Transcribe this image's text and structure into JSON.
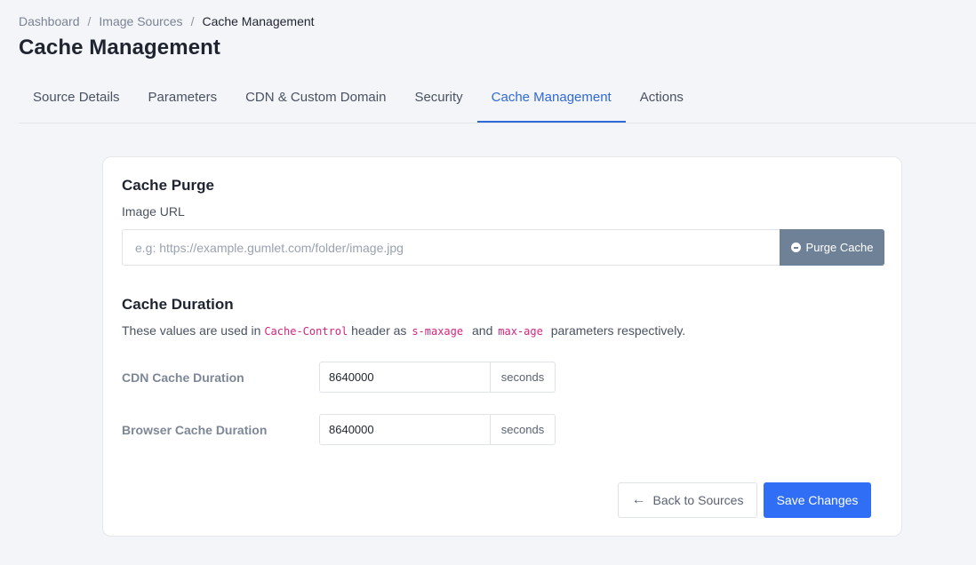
{
  "breadcrumb": {
    "items": [
      "Dashboard",
      "Image Sources"
    ],
    "current": "Cache Management",
    "separator": "/"
  },
  "page": {
    "title": "Cache Management"
  },
  "tabs": [
    {
      "label": "Source Details"
    },
    {
      "label": "Parameters"
    },
    {
      "label": "CDN & Custom Domain"
    },
    {
      "label": "Security"
    },
    {
      "label": "Cache Management",
      "active": true
    },
    {
      "label": "Actions"
    }
  ],
  "cache_purge": {
    "title": "Cache Purge",
    "url_label": "Image URL",
    "url_placeholder": "e.g: https://example.gumlet.com/folder/image.jpg",
    "url_value": "",
    "purge_button": "Purge Cache",
    "purge_icon": "minus-circle-icon"
  },
  "cache_duration": {
    "title": "Cache Duration",
    "desc_prefix": "These values are used in",
    "code_header": "Cache-Control",
    "desc_mid": "header as",
    "code_smaxage": "s-maxage",
    "desc_and": "and",
    "code_maxage": "max-age",
    "desc_suffix": "parameters respectively.",
    "cdn_label": "CDN Cache Duration",
    "cdn_value": "8640000",
    "browser_label": "Browser Cache Duration",
    "browser_value": "8640000",
    "unit": "seconds"
  },
  "footer": {
    "back_button": "Back to Sources",
    "back_icon": "arrow-left-icon",
    "save_button": "Save Changes"
  },
  "colors": {
    "accent": "#2f6ad9",
    "primary_button": "#2f6ef5",
    "purge_button": "#6f8196",
    "code": "#d6247a"
  }
}
